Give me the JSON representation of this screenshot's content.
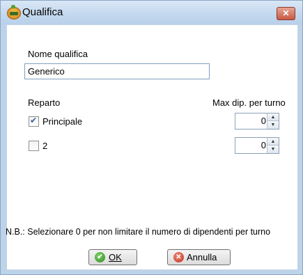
{
  "window": {
    "title": "Qualifica",
    "close_glyph": "✕",
    "app_icon": "app-logo-icon"
  },
  "form": {
    "name_label": "Nome qualifica",
    "name_value": "Generico",
    "department_header": "Reparto",
    "max_header": "Max dip. per turno",
    "departments": [
      {
        "label": "Principale",
        "checked": true,
        "max": "0"
      },
      {
        "label": "2",
        "checked": false,
        "max": "0"
      }
    ],
    "note": "N.B.: Selezionare 0 per non limitare il numero di dipendenti per turno"
  },
  "buttons": {
    "ok_label": "OK",
    "cancel_label": "Annulla",
    "ok_icon": "check-icon",
    "cancel_icon": "close-icon"
  },
  "colors": {
    "titlebar": "#c3d8ee",
    "close_button": "#c75a43",
    "ok_icon": "#2f8a1f",
    "cancel_icon": "#c0301c"
  }
}
